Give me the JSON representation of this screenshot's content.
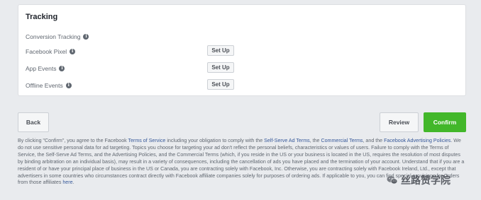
{
  "tracking": {
    "title": "Tracking",
    "conversion_label": "Conversion Tracking",
    "rows": [
      {
        "label": "Facebook Pixel",
        "button": "Set Up"
      },
      {
        "label": "App Events",
        "button": "Set Up"
      },
      {
        "label": "Offline Events",
        "button": "Set Up"
      }
    ]
  },
  "footer": {
    "back_label": "Back",
    "review_label": "Review",
    "confirm_label": "Confirm"
  },
  "legal": {
    "p1": "By clicking \"Confirm\", you agree to the Facebook ",
    "link_tos": "Terms of Service",
    "p2": " including your obligation to comply with the ",
    "link_ssat": "Self-Serve Ad Terms",
    "p3": ", the ",
    "link_ct": "Commercial Terms",
    "p4": ", and the ",
    "link_fap": "Facebook Advertising Policies",
    "p5": ". We do not use sensitive personal data for ad targeting. Topics you choose for targeting your ad don't reflect the personal beliefs, characteristics or values of users. Failure to comply with the Terms of Service, the Self-Serve Ad Terms, and the Advertising Policies, and the Commercial Terms (which, if you reside in the US or your business is located in the US, requires the resolution of most disputes by binding arbitration on an individual basis), may result in a variety of consequences, including the cancellation of ads you have placed and the termination of your account. Understand that if you are a resident of or have your principal place of business in the US or Canada, you are contracting solely with Facebook, Inc. Otherwise, you are contracting solely with Facebook Ireland, Ltd., except that advertisers in some countries who circumstances contract directly with Facebook affiliate companies solely for purposes of ordering ads. If applicable to you, you can find special provisions for Orders from those affiliates ",
    "link_here": "here",
    "p6": "."
  },
  "watermark": {
    "text": "丝路赞学院",
    "icon": "wechat-logo-icon"
  },
  "colors": {
    "background": "#e9ebee",
    "link": "#365899",
    "confirm": "#42b72a"
  }
}
